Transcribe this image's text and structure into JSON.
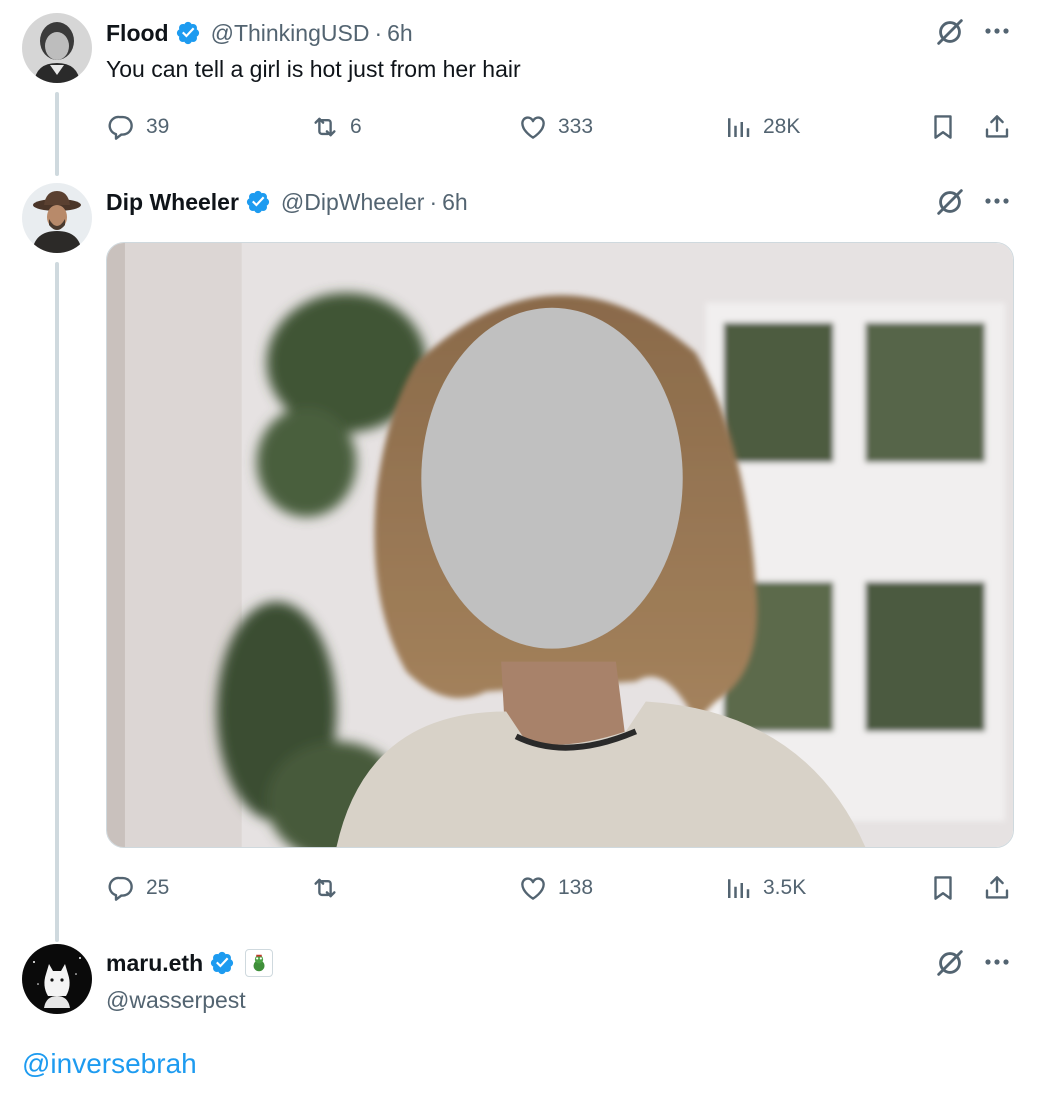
{
  "tweets": [
    {
      "name": "Flood",
      "handle": "@ThinkingUSD",
      "separator": "·",
      "time": "6h",
      "text": "You can tell a girl is hot just from her hair",
      "replies": "39",
      "reposts": "6",
      "likes": "333",
      "views": "28K"
    },
    {
      "name": "Dip Wheeler",
      "handle": "@DipWheeler",
      "separator": "·",
      "time": "6h",
      "replies": "25",
      "reposts": "",
      "likes": "138",
      "views": "3.5K"
    },
    {
      "name": "maru.eth",
      "handle": "@wasserpest",
      "mention": "@inversebrah"
    }
  ],
  "icons": {
    "verified": "verified-badge-icon",
    "grok": "grok-icon",
    "more": "more-icon",
    "reply": "reply-icon",
    "repost": "repost-icon",
    "like": "like-icon",
    "views": "views-icon",
    "bookmark": "bookmark-icon",
    "share": "share-icon"
  },
  "colors": {
    "accent": "#1d9bf0",
    "text": "#0f1419",
    "secondary": "#536471",
    "thread_line": "#cfd9de"
  }
}
